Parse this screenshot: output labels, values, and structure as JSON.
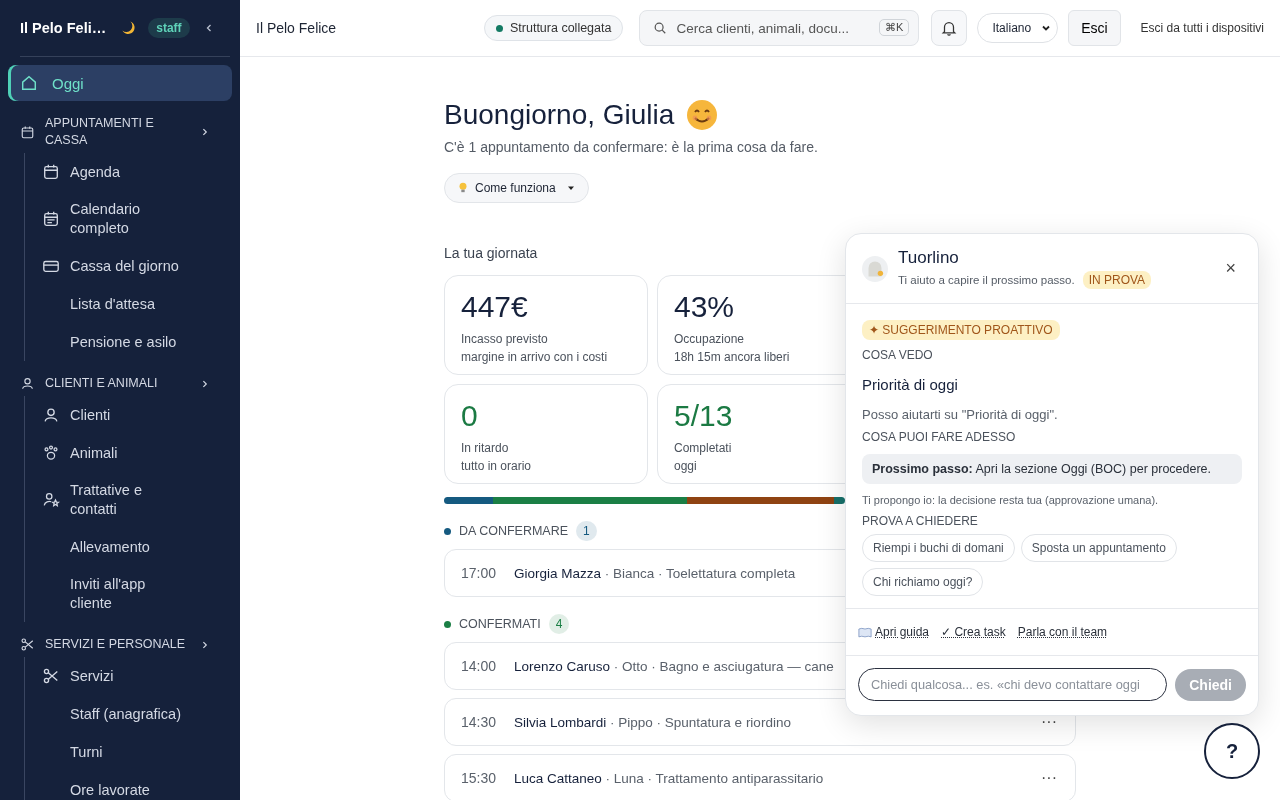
{
  "sidebar": {
    "brand": "Il Pelo Feli…",
    "badge": "staff",
    "items": [
      {
        "kind": "link",
        "label": "Oggi",
        "selected": true
      },
      {
        "kind": "section",
        "label": "APPUNTAMENTI E CASSA",
        "selected": false,
        "children": [
          {
            "label": "Agenda",
            "selected": false
          },
          {
            "label": "Calendario completo",
            "selected": false
          },
          {
            "label": "Cassa del giorno",
            "selected": false
          },
          {
            "label": "Lista d'attesa",
            "selected": false
          },
          {
            "label": "Pensione e asilo",
            "selected": false
          }
        ]
      },
      {
        "kind": "section",
        "label": "CLIENTI E ANIMALI",
        "selected": false,
        "children": [
          {
            "label": "Clienti",
            "selected": false
          },
          {
            "label": "Animali",
            "selected": false
          },
          {
            "label": "Trattative e contatti",
            "selected": false
          },
          {
            "label": "Allevamento",
            "selected": false
          },
          {
            "label": "Inviti all'app cliente",
            "selected": false
          }
        ]
      },
      {
        "kind": "section",
        "label": "SERVIZI E PERSONALE",
        "selected": false,
        "children": [
          {
            "label": "Servizi",
            "selected": false
          },
          {
            "label": "Staff (anagrafica)",
            "selected": false
          },
          {
            "label": "Turni",
            "selected": false
          },
          {
            "label": "Ore lavorate",
            "selected": false
          }
        ]
      }
    ]
  },
  "topbar": {
    "title": "Il Pelo Felice",
    "status": {
      "label": "Struttura collegata",
      "color": "#137a63"
    },
    "search": {
      "placeholder": "Cerca clienti, animali, docu...",
      "shortcut": "⌘K"
    },
    "language": "Italiano",
    "logout": "Esci",
    "logout_all": "Esci da tutti i dispositivi"
  },
  "greeting": {
    "title": "Buongiorno, Giulia",
    "subtitle": "C'è 1 appuntamento da confermare: è la prima cosa da fare.",
    "help": "Come funziona"
  },
  "day": {
    "title": "La tua giornata",
    "cards": [
      {
        "value": "447€",
        "label": "Incasso previsto",
        "note": "margine in arrivo con i costi",
        "color": "#16213b"
      },
      {
        "value": "43%",
        "label": "Occupazione",
        "note": "18h 15m ancora liberi",
        "color": "#16213b"
      },
      {
        "value": "0",
        "label": "In ritardo",
        "note": "tutto in orario",
        "color": "#1b7a43"
      },
      {
        "value": "5/13",
        "label": "Completati",
        "note": "oggi",
        "color": "#1b7a43"
      }
    ]
  },
  "groups": [
    {
      "title": "DA CONFERMARE",
      "count": "1",
      "color": "#155a80",
      "rows": [
        {
          "time": "17:00",
          "details": "**Giorgia Mazza** · Bianca · Toelettatura completa"
        }
      ]
    },
    {
      "title": "CONFERMATI",
      "count": "4",
      "color": "#1b7f45",
      "rows": [
        {
          "time": "14:00",
          "details": "**Lorenzo Caruso** · Otto · Bagno e asciugatura — cane"
        },
        {
          "time": "14:30",
          "details": "**Silvia Lombardi** · Pippo · Spuntatura e riordino",
          "more": "···"
        },
        {
          "time": "15:30",
          "details": "**Luca Cattaneo** · Luna · Trattamento antiparassitario",
          "more": "···"
        }
      ]
    }
  ],
  "assistant": {
    "name": "Tuorlino",
    "tagline": "Ti aiuto a capire il prossimo passo.",
    "badge": "IN PROVA",
    "close": "×",
    "suggestion": "✦ SUGGERIMENTO PROATTIVO",
    "see_label": "COSA VEDO",
    "see_title": "Priorità di oggi",
    "see_text": "Posso aiutarti su \"Priorità di oggi\".",
    "do_label": "COSA PUOI FARE ADESSO",
    "next_step": "**Prossimo passo:** Apri la sezione Oggi (BOC) per procedere.",
    "note": "Ti propongo io: la decisione resta tua (approvazione umana).",
    "ask_label": "PROVA A CHIEDERE",
    "chips": [
      "Riempi i buchi di domani",
      "Sposta un appuntamento",
      "Chi richiamo oggi?"
    ],
    "links": [
      "Apri guida",
      "✓ Crea task",
      "Parla con il team"
    ],
    "input": {
      "placeholder": "Chiedi qualcosa... es. «chi devo contattare oggi"
    },
    "send": {
      "label": "Chiedi",
      "disabled": true
    }
  },
  "help_button": "?"
}
